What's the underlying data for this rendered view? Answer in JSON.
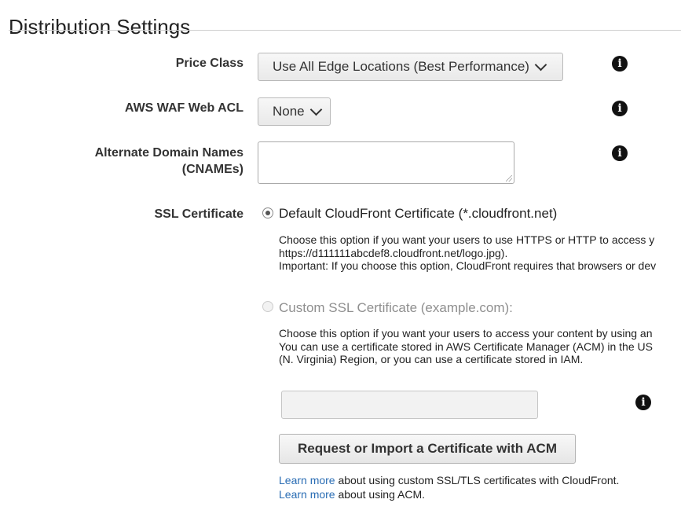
{
  "section": {
    "title": "Distribution Settings"
  },
  "price_class": {
    "label": "Price Class",
    "value": "Use All Edge Locations (Best Performance)"
  },
  "waf": {
    "label": "AWS WAF Web ACL",
    "value": "None"
  },
  "cnames": {
    "label_line1": "Alternate Domain Names",
    "label_line2": "(CNAMEs)",
    "value": ""
  },
  "ssl": {
    "label": "SSL Certificate",
    "default_option": {
      "label": "Default CloudFront Certificate (*.cloudfront.net)",
      "selected": true,
      "desc_line1": "Choose this option if you want your users to use HTTPS or HTTP to access y",
      "desc_line2": "https://d111111abcdef8.cloudfront.net/logo.jpg).",
      "desc_line3": "Important: If you choose this option, CloudFront requires that browsers or dev"
    },
    "custom_option": {
      "label": "Custom SSL Certificate (example.com):",
      "selected": false,
      "desc_line1": "Choose this option if you want your users to access your content by using an",
      "desc_line2": "You can use a certificate stored in AWS Certificate Manager (ACM) in the US",
      "desc_line3": "(N. Virginia) Region, or you can use a certificate stored in IAM."
    },
    "certificate_input_value": "",
    "acm_button_label": "Request or Import a Certificate with ACM",
    "learn_more_1": {
      "link": "Learn more",
      "text": " about using custom SSL/TLS certificates with CloudFront."
    },
    "learn_more_2": {
      "link": "Learn more",
      "text": " about using ACM."
    }
  },
  "info_icon_glyph": "i"
}
